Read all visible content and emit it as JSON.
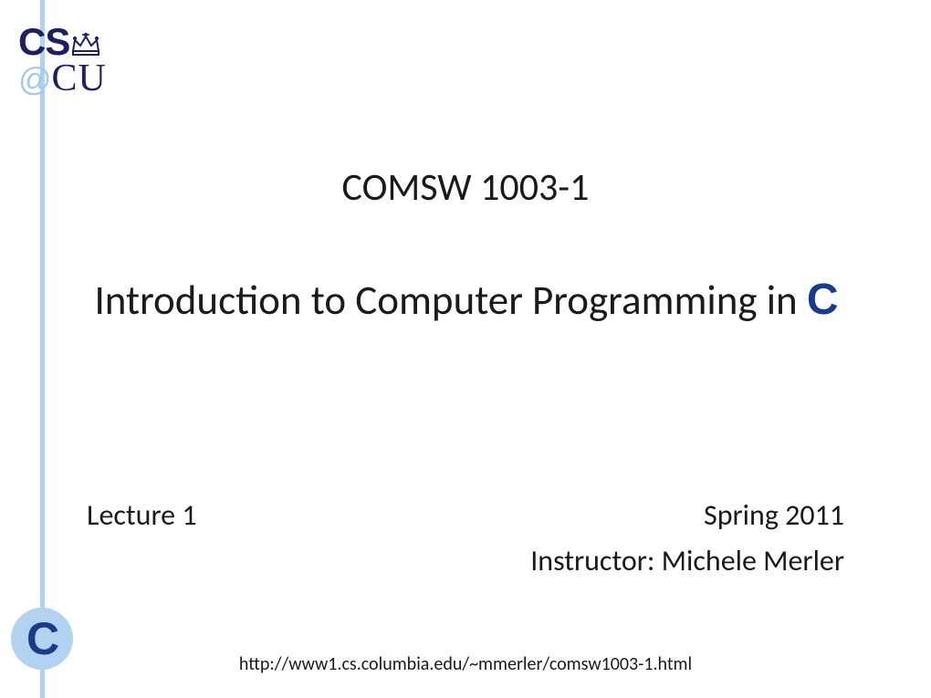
{
  "logo": {
    "cs": "CS",
    "at": "@",
    "cu": "CU"
  },
  "course_code": "COMSW 1003-1",
  "course_title_prefix": "Introduction to Computer Programming in ",
  "course_title_lang": "C",
  "lecture": "Lecture 1",
  "term": "Spring 2011",
  "instructor": "Instructor: Michele Merler",
  "c_badge": "C",
  "url": "http://www1.cs.columbia.edu/~mmerler/comsw1003-1.html"
}
